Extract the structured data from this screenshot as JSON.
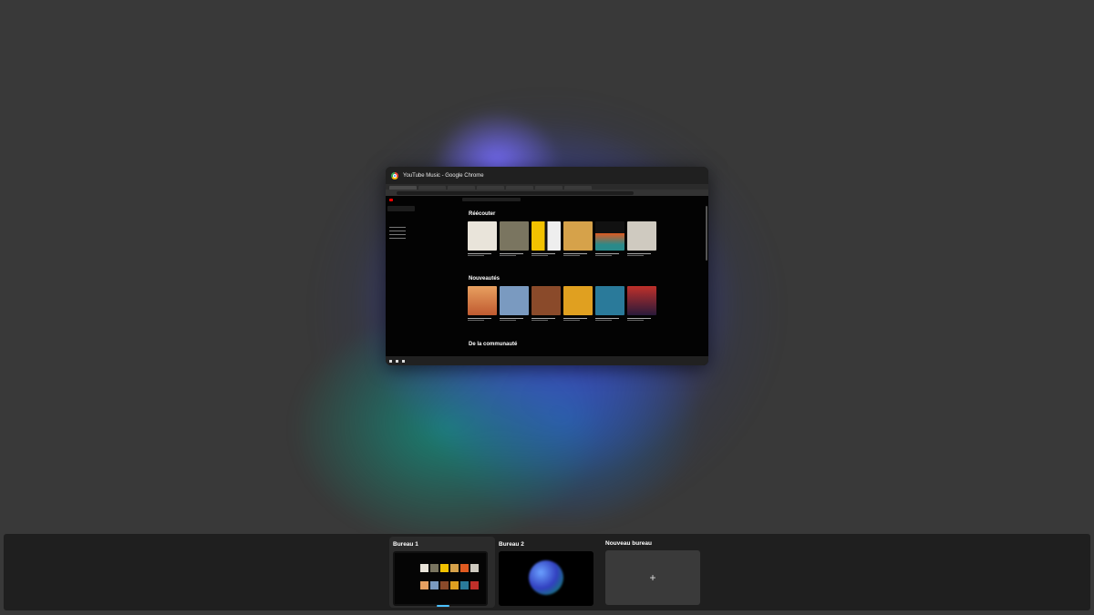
{
  "window": {
    "title": "YouTube Music - Google Chrome",
    "app_icon": "chrome-icon",
    "sections": [
      "Réécouter",
      "Nouveautés",
      "De la communauté"
    ]
  },
  "colors": {
    "wallpaper": "#393939",
    "active_desktop_indicator": "#4cc2ff",
    "youtube_red": "#ff0000"
  },
  "task_view": {
    "desktops": [
      {
        "label": "Bureau 1",
        "active": true
      },
      {
        "label": "Bureau 2",
        "active": false
      }
    ],
    "new_desktop": {
      "label": "Nouveau bureau",
      "icon": "plus-icon",
      "glyph": "+"
    }
  }
}
